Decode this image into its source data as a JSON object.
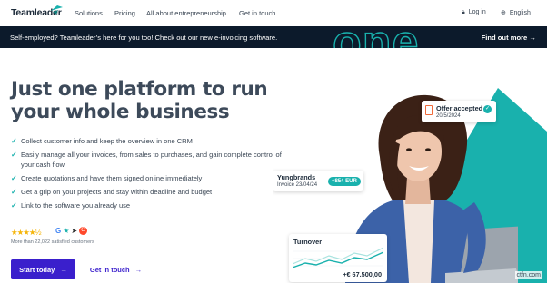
{
  "nav": {
    "logo": "Teamleader",
    "links": [
      "Solutions",
      "Pricing",
      "All about entrepreneurship",
      "Get in touch"
    ],
    "login": "Log in",
    "language": "English"
  },
  "banner": {
    "text": "Self-employed? Teamleader’s here for you too! Check out our new e-invoicing software.",
    "cta": "Find out more",
    "decor_word": "one"
  },
  "hero": {
    "title_before": "Just ",
    "title_highlight": "one platform",
    "title_after": " to run your whole business",
    "features": [
      "Collect customer info and keep the overview in one CRM",
      "Easily manage all your invoices, from sales to purchases, and gain complete control of your cash flow",
      "Create quotations and have them signed online immediately",
      "Get a grip on your projects and stay within deadline and budget",
      "Link to the software you already use"
    ],
    "rating_stars": "★★★★½",
    "rating_value": 4.5,
    "rating_sub": "More than 22,022 satisfied customers",
    "primary_cta": "Start today",
    "secondary_cta": "Get in touch"
  },
  "cards": {
    "offer": {
      "title": "Offer accepted",
      "date": "20/5/2024"
    },
    "invoice": {
      "title": "Yungbrands",
      "sub": "Invoice 23/04/24",
      "amount": "+854 EUR"
    },
    "turnover": {
      "title": "Turnover",
      "amount": "+€ 67.500,00"
    }
  },
  "watermark": "ctfn.com",
  "colors": {
    "accent": "#19b1ad",
    "primary": "#3a1fcc",
    "navy": "#0c1a2b",
    "star": "#f5b50a"
  }
}
